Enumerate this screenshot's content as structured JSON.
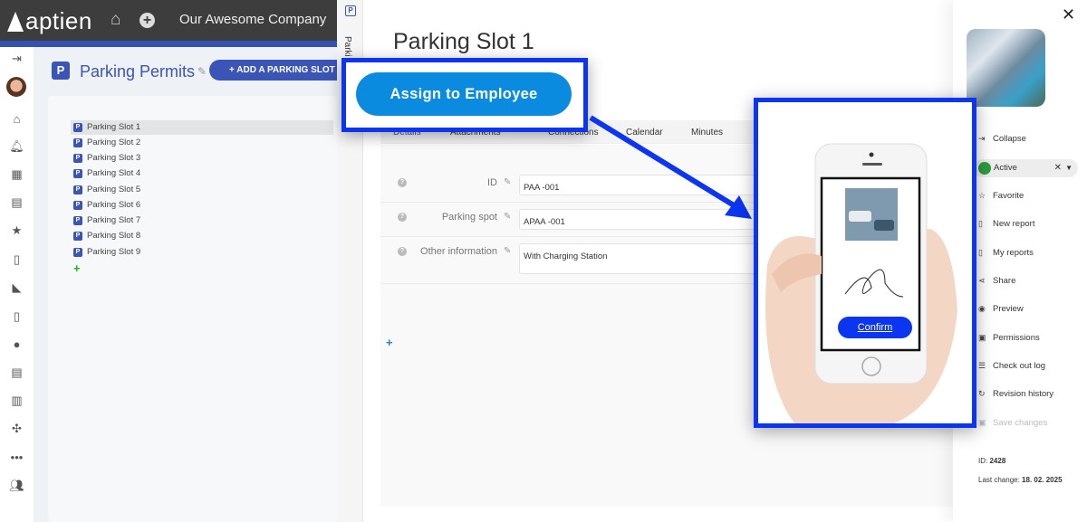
{
  "topbar": {
    "logo": "aptien",
    "company": "Our Awesome Company",
    "icons": [
      "home-icon",
      "plus-circle-icon"
    ]
  },
  "leftnav": {
    "icons": [
      "expand-arrow-icon",
      "avatar",
      "home-icon",
      "bell-icon",
      "calendar-icon",
      "clipboard-icon",
      "star-icon",
      "document-icon",
      "dog-icon",
      "report-icon",
      "person-icon",
      "clipboard-list-icon",
      "library-icon",
      "network-icon",
      "grid-icon",
      "team-icon"
    ]
  },
  "list": {
    "title": "Parking Permits",
    "add_button": "+ ADD A PARKING SLOT",
    "items": [
      "Parking Slot 1",
      "Parking Slot 2",
      "Parking Slot 3",
      "Parking Slot 4",
      "Parking Slot 5",
      "Parking Slot 6",
      "Parking Slot 7",
      "Parking Slot 8",
      "Parking Slot 9"
    ],
    "selected": "Parking Slot 1"
  },
  "panel": {
    "strip_label": "Parki",
    "title": "Parking Slot 1",
    "tabs": [
      "Details",
      "Attachments",
      "Connections",
      "Calendar",
      "Minutes"
    ],
    "fields": [
      {
        "label": "ID",
        "value": "PAA -001"
      },
      {
        "label": "Parking spot",
        "value": "APAA -001"
      },
      {
        "label": "Other information",
        "value": "With Charging Station"
      }
    ]
  },
  "sidebar": {
    "items": [
      {
        "icon": "collapse-icon",
        "label": "Collapse"
      },
      {
        "icon": "star-icon",
        "label": "Favorite"
      },
      {
        "icon": "new-report-icon",
        "label": "New report"
      },
      {
        "icon": "report-icon",
        "label": "My reports"
      },
      {
        "icon": "share-icon",
        "label": "Share"
      },
      {
        "icon": "eye-icon",
        "label": "Preview"
      },
      {
        "icon": "permissions-icon",
        "label": "Permissions"
      },
      {
        "icon": "checkout-icon",
        "label": "Check out log"
      },
      {
        "icon": "history-icon",
        "label": "Revision history"
      },
      {
        "icon": "save-icon",
        "label": "Save changes"
      }
    ],
    "status": "Active",
    "status_color": "#2e9c3d",
    "id_label": "ID:",
    "id": "2428",
    "last_change_label": "Last change:",
    "last_change": "18. 02. 2025"
  },
  "callout": {
    "assign_button": "Assign to Employee",
    "confirm_button": "Confirm",
    "accent": "#0b35f0"
  }
}
